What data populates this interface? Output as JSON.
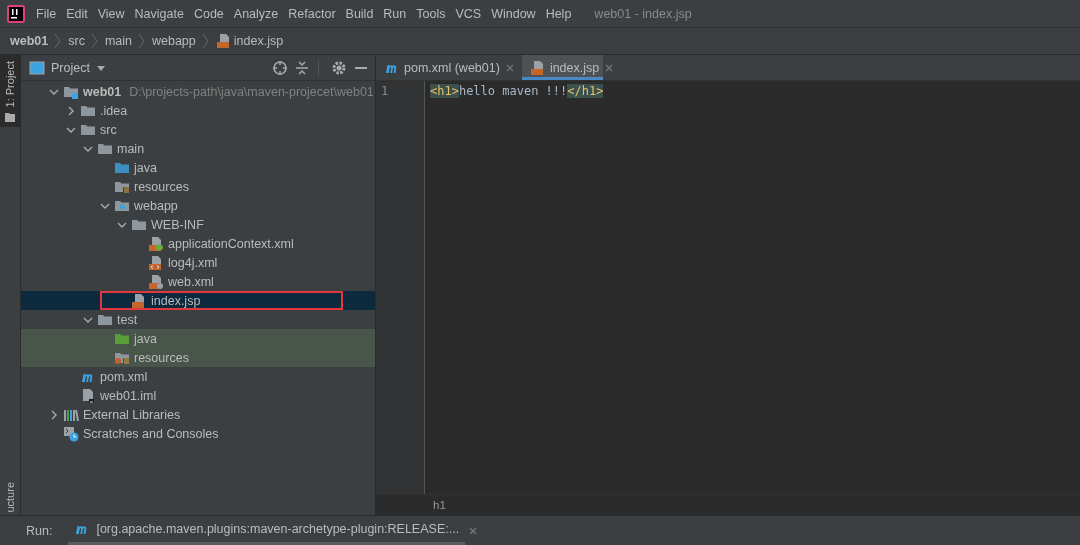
{
  "window": {
    "title": "web01 - index.jsp"
  },
  "menu": [
    "File",
    "Edit",
    "View",
    "Navigate",
    "Code",
    "Analyze",
    "Refactor",
    "Build",
    "Run",
    "Tools",
    "VCS",
    "Window",
    "Help"
  ],
  "breadcrumbs": [
    {
      "label": "web01",
      "kind": "project"
    },
    {
      "label": "src",
      "kind": "folder"
    },
    {
      "label": "main",
      "kind": "folder"
    },
    {
      "label": "webapp",
      "kind": "folder"
    },
    {
      "label": "index.jsp",
      "kind": "jsp"
    }
  ],
  "side_strip": {
    "top": "1: Project",
    "bottom": "ucture"
  },
  "project_panel": {
    "title": "Project",
    "tree": [
      {
        "label": "web01",
        "path": "D:\\projects-path\\java\\maven-projecet\\web01",
        "kind": "module",
        "expanded": true,
        "selected": false,
        "children": [
          {
            "label": ".idea",
            "kind": "folder",
            "expanded": false,
            "selected": false
          },
          {
            "label": "src",
            "kind": "folder",
            "expanded": true,
            "selected": false,
            "children": [
              {
                "label": "main",
                "kind": "folder",
                "expanded": true,
                "selected": false,
                "children": [
                  {
                    "label": "java",
                    "kind": "source",
                    "selected": false
                  },
                  {
                    "label": "resources",
                    "kind": "resources",
                    "selected": false
                  },
                  {
                    "label": "webapp",
                    "kind": "web",
                    "expanded": true,
                    "selected": false,
                    "children": [
                      {
                        "label": "WEB-INF",
                        "kind": "folder",
                        "expanded": true,
                        "selected": false,
                        "children": [
                          {
                            "label": "applicationContext.xml",
                            "kind": "spring-xml",
                            "selected": false
                          },
                          {
                            "label": "log4j.xml",
                            "kind": "xml",
                            "selected": false
                          },
                          {
                            "label": "web.xml",
                            "kind": "web-xml",
                            "selected": false
                          }
                        ]
                      },
                      {
                        "label": "index.jsp",
                        "kind": "jsp",
                        "selected": true,
                        "annotated": true
                      }
                    ]
                  }
                ]
              },
              {
                "label": "test",
                "kind": "folder",
                "expanded": true,
                "selected": false,
                "children": [
                  {
                    "label": "java",
                    "kind": "test-source",
                    "selected": false
                  },
                  {
                    "label": "resources",
                    "kind": "test-resources",
                    "selected": false
                  }
                ]
              }
            ]
          },
          {
            "label": "pom.xml",
            "kind": "maven",
            "selected": false
          },
          {
            "label": "web01.iml",
            "kind": "iml",
            "selected": false
          }
        ]
      },
      {
        "label": "External Libraries",
        "kind": "libraries",
        "expanded": false,
        "selected": false
      },
      {
        "label": "Scratches and Consoles",
        "kind": "scratches",
        "selected": false
      }
    ]
  },
  "editor": {
    "tabs": [
      {
        "label": "pom.xml (web01)",
        "kind": "maven",
        "selected": false
      },
      {
        "label": "index.jsp",
        "kind": "jsp",
        "selected": true
      }
    ],
    "lines": [
      {
        "number": "1",
        "tokens": [
          {
            "kind": "tag",
            "text": "<h1>"
          },
          {
            "kind": "text",
            "text": "hello maven !!!"
          },
          {
            "kind": "tag",
            "text": "</h1>"
          }
        ]
      }
    ],
    "status_path": "h1"
  },
  "run_bar": {
    "label": "Run:",
    "tab": "[org.apache.maven.plugins:maven-archetype-plugin:RELEASE:..."
  }
}
